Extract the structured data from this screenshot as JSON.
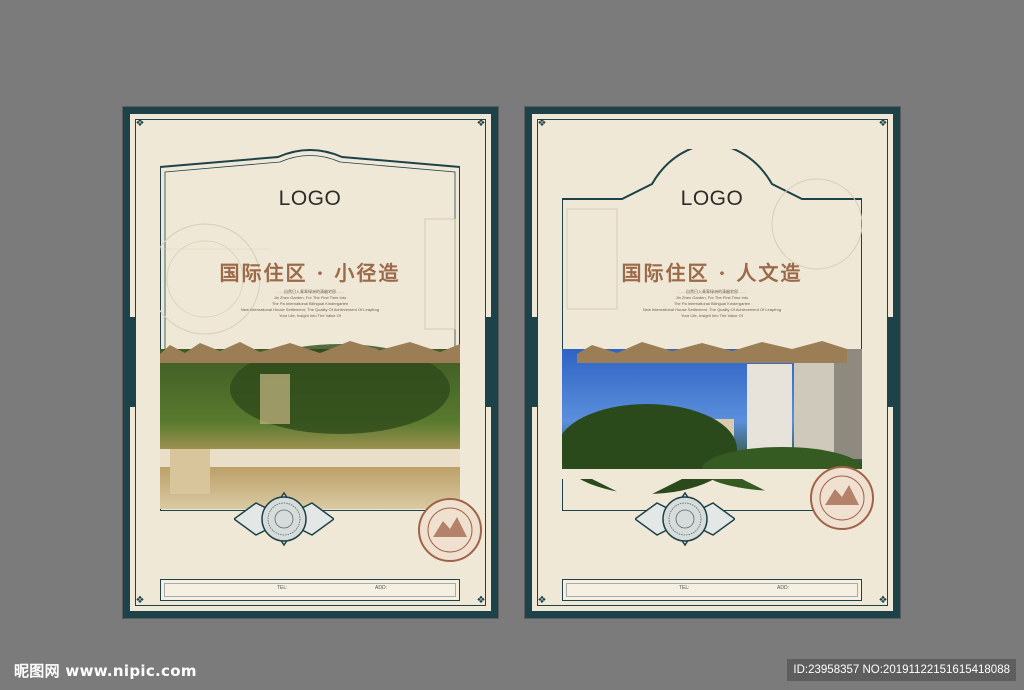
{
  "posters": [
    {
      "logo": "LOGO",
      "title": "国际住区 · 小径造",
      "fine_print": [
        "……自然日入青翠绿洲的清幽宅邸……",
        "Jin Zhen Garden, For The First Time Into",
        "The Pa International Bilingual Kindergarten",
        "New International House Settlement, The Quality Of Achievement Of Leapfrog",
        "Your Life, Insight Into The Value Of"
      ],
      "footer": {
        "tel_label": "TEL:",
        "add_label": "ADD:"
      },
      "stamp_text": "HIGH IN THE ROCKY MOUNTAINS",
      "icons": [
        "medallion-ornament",
        "vintage-stamp"
      ]
    },
    {
      "logo": "LOGO",
      "title": "国际住区 · 人文造",
      "fine_print": [
        "……自然日入青翠绿洲的清幽宅邸……",
        "Jin Zhen Garden, For The First Time Into",
        "The Pa International Bilingual Kindergarten",
        "New International House Settlement, The Quality Of Achievement Of Leapfrog",
        "Your Life, Insight Into The Value Of"
      ],
      "footer": {
        "tel_label": "TEL:",
        "add_label": "ADD:"
      },
      "stamp_text": "HIGH IN THE ROCKY MOUNTAINS",
      "icons": [
        "medallion-ornament",
        "vintage-stamp"
      ]
    }
  ],
  "watermark": "昵图网 www.nipic.com",
  "image_id": "ID:23958357 NO:20191122151615418088",
  "colors": {
    "frame": "#1d4249",
    "paper": "#efe8d6",
    "title": "#9c6a4a",
    "background": "#7b7b7b"
  }
}
